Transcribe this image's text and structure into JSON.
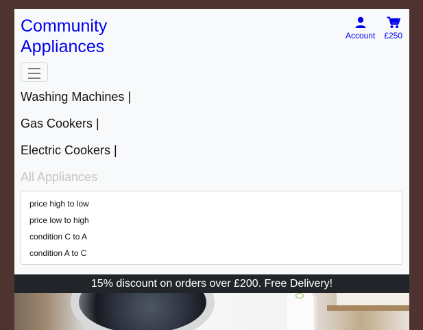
{
  "header": {
    "brand": "Community Appliances",
    "links": [
      {
        "label": "Account",
        "icon": "user-icon"
      },
      {
        "label": "£250",
        "icon": "cart-icon"
      }
    ]
  },
  "nav": {
    "toggle_icon": "hamburger-menu-icon",
    "items": [
      {
        "label": "Washing Machines |"
      },
      {
        "label": "Gas Cookers |"
      },
      {
        "label": "Electric Cookers |"
      },
      {
        "label": "All Appliances"
      }
    ]
  },
  "sort": {
    "options": [
      "price high to low",
      "price low to high",
      "condition C to A",
      "condition A to C"
    ]
  },
  "banner": {
    "text": "15% discount on orders over £200. Free Delivery!"
  },
  "colors": {
    "link": "#0000ee",
    "banner_bg": "#212529",
    "page_bg": "#4e3330"
  }
}
